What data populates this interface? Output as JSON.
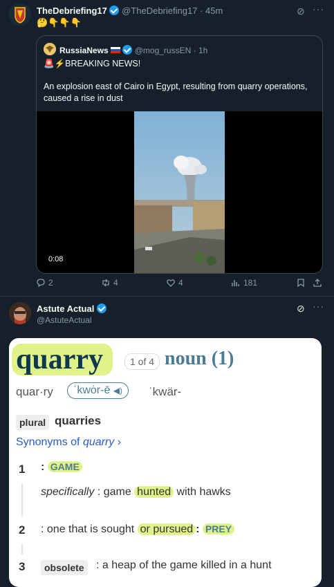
{
  "tweet1": {
    "author_name": "TheDebriefing17",
    "handle": "@TheDebriefing17",
    "time": "45m",
    "emojis": "🤔👇👇👇",
    "quote": {
      "author_name": "RussiaNews",
      "flag": "🇷🇺",
      "handle": "@mog_russEN",
      "time": "1h",
      "headline": "🚨⚡BREAKING NEWS!",
      "body": "An explosion east of Cairo in Egypt, resulting from quarry operations, caused a rise in dust",
      "video_duration": "0:08"
    },
    "actions": {
      "replies": "2",
      "reposts": "4",
      "likes": "4",
      "views": "181"
    }
  },
  "tweet2": {
    "author_name": "Astute Actual",
    "handle": "@AstuteActual"
  },
  "dictionary": {
    "word": "quarry",
    "entry_index": "1 of 4",
    "pos": "noun (1)",
    "syllables": "quar·ry",
    "pron1": "ˈkwȯr-ē",
    "pron2": "ˈkwär-",
    "plural_label": "plural",
    "plural": "quarries",
    "synonyms_prefix": "Synonyms of ",
    "synonyms_word": "quarry",
    "defs": {
      "d1_num": "1",
      "d1_colon": ":",
      "d1_word": "GAME",
      "d1_spec_label": "specifically",
      "d1_spec_colon": " : game ",
      "d1_spec_hl": "hunted",
      "d1_spec_tail": " with hawks",
      "d2_num": "2",
      "d2_text": ": one that is sought ",
      "d2_hl": "or pursued",
      "d2_colon": ":",
      "d2_word": "PREY",
      "d3_num": "3",
      "d3_label": "obsolete",
      "d3_text": ": a heap of the game killed in a hunt"
    }
  },
  "colors": {
    "background": "#15202b",
    "accent": "#1d9bf0",
    "highlight": "#dff38a",
    "mw_blue": "#4a7d95"
  }
}
